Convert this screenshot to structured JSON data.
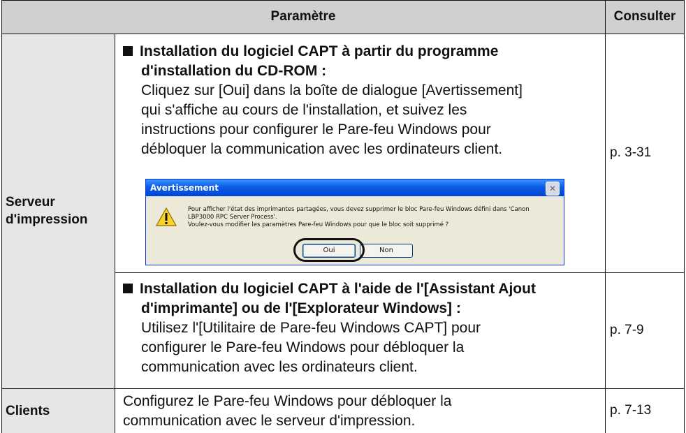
{
  "table": {
    "header": {
      "parametre": "Paramètre",
      "consulter": "Consulter"
    },
    "rows": {
      "serveur": {
        "label_line1": "Serveur",
        "label_line2": "d'impression",
        "section1": {
          "title_line1": "Installation du logiciel CAPT à partir du programme",
          "title_line2": "d'installation du CD-ROM :",
          "body_line1": "Cliquez sur [Oui] dans la boîte de dialogue [Avertissement]",
          "body_line2": "qui s'affiche au cours de l'installation, et suivez les",
          "body_line3": "instructions pour configurer le Pare-feu Windows pour",
          "body_line4": "débloquer la communication avec les ordinateurs client.",
          "reference": "p. 3-31"
        },
        "section2": {
          "title_line1": "Installation du logiciel CAPT à l'aide de l'[Assistant Ajout",
          "title_line2": "d'imprimante] ou de l'[Explorateur Windows] :",
          "body_line1": "Utilisez l'[Utilitaire de Pare-feu Windows CAPT] pour",
          "body_line2": "configurer le Pare-feu Windows pour débloquer la",
          "body_line3": "communication avec les ordinateurs client.",
          "reference": "p. 7-9"
        }
      },
      "clients": {
        "label": "Clients",
        "body_line1": "Configurez le Pare-feu Windows pour débloquer la",
        "body_line2": "communication avec le serveur d'impression.",
        "reference": "p. 7-13"
      }
    }
  },
  "dialog": {
    "title": "Avertissement",
    "message_line1": "Pour afficher l'état des imprimantes partagées, vous devez supprimer le bloc Pare-feu Windows défini dans 'Canon",
    "message_line2": "LBP3000 RPC Server Process'.",
    "message_line3": "Voulez-vous modifier les paramètres Pare-feu Windows pour que le bloc soit supprimé ?",
    "yes_label": "Oui",
    "no_label": "Non",
    "icon": "warning-icon",
    "close_icon": "close-icon"
  },
  "colors": {
    "header_bg": "#d0d0d0",
    "side_bg": "#e6e6e6",
    "dialog_title": "#0a5ce6",
    "dialog_bg": "#ece9d8"
  }
}
